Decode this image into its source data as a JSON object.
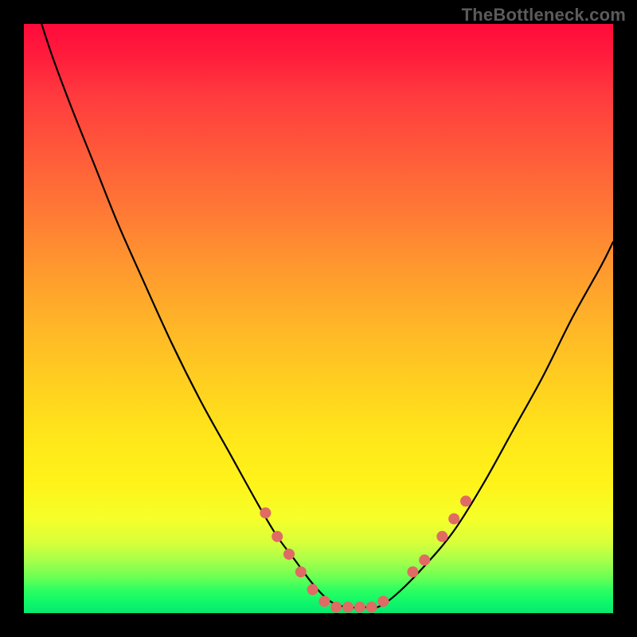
{
  "watermark": "TheBottleneck.com",
  "chart_data": {
    "type": "line",
    "title": "",
    "xlabel": "",
    "ylabel": "",
    "xlim": [
      0,
      100
    ],
    "ylim": [
      0,
      100
    ],
    "grid": false,
    "legend": false,
    "series": [
      {
        "name": "bottleneck-curve",
        "color": "#000000",
        "x": [
          3,
          5,
          8,
          12,
          16,
          20,
          25,
          30,
          35,
          40,
          43,
          46,
          49,
          52,
          55,
          58,
          60,
          63,
          68,
          73,
          78,
          83,
          88,
          93,
          98,
          100
        ],
        "y": [
          100,
          94,
          86,
          76,
          66,
          57,
          46,
          36,
          27,
          18,
          13,
          9,
          5,
          2,
          1,
          1,
          1,
          3,
          8,
          14,
          22,
          31,
          40,
          50,
          59,
          63
        ]
      }
    ],
    "markers": [
      {
        "name": "highlight-dots",
        "color": "#e06a64",
        "radius": 7,
        "points": [
          {
            "x": 41,
            "y": 17
          },
          {
            "x": 43,
            "y": 13
          },
          {
            "x": 45,
            "y": 10
          },
          {
            "x": 47,
            "y": 7
          },
          {
            "x": 49,
            "y": 4
          },
          {
            "x": 51,
            "y": 2
          },
          {
            "x": 53,
            "y": 1
          },
          {
            "x": 55,
            "y": 1
          },
          {
            "x": 57,
            "y": 1
          },
          {
            "x": 59,
            "y": 1
          },
          {
            "x": 61,
            "y": 2
          },
          {
            "x": 66,
            "y": 7
          },
          {
            "x": 68,
            "y": 9
          },
          {
            "x": 71,
            "y": 13
          },
          {
            "x": 73,
            "y": 16
          },
          {
            "x": 75,
            "y": 19
          }
        ]
      }
    ]
  }
}
